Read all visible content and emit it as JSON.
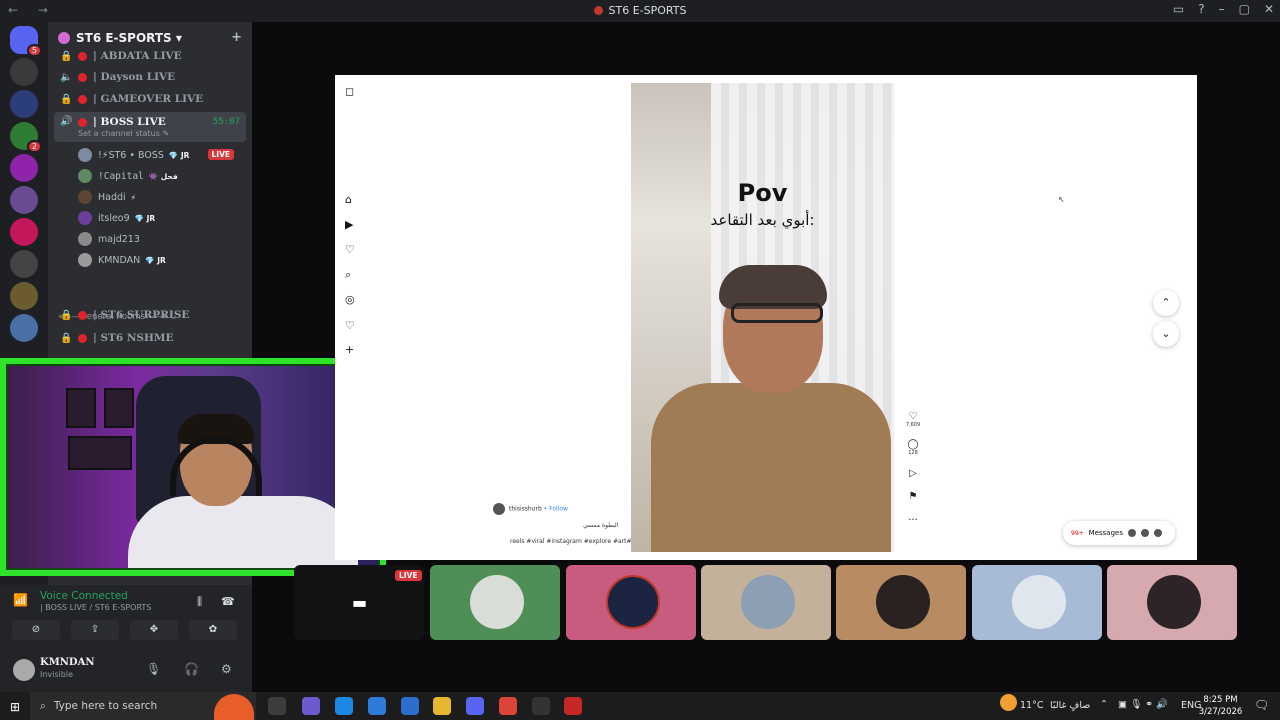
{
  "window": {
    "title": "ST6 E-SPORTS",
    "nav": "← →",
    "controls": [
      "▭",
      "?",
      "–",
      "▢",
      "✕"
    ]
  },
  "servers": [
    {
      "name": "discord-home",
      "color": "#5865f2",
      "badge": "5"
    },
    {
      "name": "st6",
      "color": "#3a3a3a",
      "badge": ""
    },
    {
      "name": "server-3",
      "color": "#2c3e7a",
      "badge": ""
    },
    {
      "name": "xjc",
      "color": "#2e7d32",
      "badge": "2"
    },
    {
      "name": "m7",
      "color": "#8e24aa",
      "badge": ""
    },
    {
      "name": "server-6",
      "color": "#6a4c93",
      "badge": ""
    },
    {
      "name": "mesk",
      "color": "#c2185b",
      "badge": ""
    },
    {
      "name": "server-8",
      "color": "#444",
      "badge": ""
    },
    {
      "name": "sx",
      "color": "#6b5b2e",
      "badge": ""
    },
    {
      "name": "server-10",
      "color": "#4a6fa5",
      "badge": ""
    }
  ],
  "guild": {
    "name": "ST6 E-SPORTS ▾",
    "add_user_icon": "+"
  },
  "channels": [
    {
      "name": "| ABDATA LIVE",
      "icon": "🔒",
      "y": -8
    },
    {
      "name": "| Dayson LIVE",
      "icon": "🔈",
      "y": 14
    },
    {
      "name": "| GAMEOVER LIVE",
      "icon": "🔒",
      "y": 37
    }
  ],
  "active_channel": {
    "name": "| BOSS LIVE",
    "time": "55:07",
    "status": "Set a channel status ✎"
  },
  "members": [
    {
      "name": "!⚡ST6 • BOSS",
      "tag": "💎 JR",
      "color": "#7d8aa0",
      "live": "LIVE"
    },
    {
      "name": "!Capital",
      "tag": "👾 فحل",
      "color": "#5e8a63",
      "live": ""
    },
    {
      "name": "Haddi",
      "tag": "⚡",
      "color": "#5b4636",
      "live": ""
    },
    {
      "name": "itsleo9",
      "tag": "💎 JR",
      "color": "#6b3e9a",
      "live": ""
    },
    {
      "name": "majd213",
      "tag": "",
      "color": "#8a8a8a",
      "live": ""
    },
    {
      "name": "KMNDAN",
      "tag": "💎 JR",
      "color": "#9a9a9a",
      "live": ""
    }
  ],
  "category": "«——General Rooms——» ⌄",
  "more_channels": [
    {
      "name": "| ST6 SURPRISE",
      "icon": "🔒"
    },
    {
      "name": "| ST6 NSHME",
      "icon": "🔒"
    }
  ],
  "instagram": {
    "pov": "Pov",
    "arabic_caption": "أبوي بعد التقاعد:",
    "likes": "7,609",
    "comments": "128",
    "account": "thisisshurb",
    "follow": "• Follow",
    "caption_line1": "البطوة ممسي",
    "caption_line2": "reels #viral #instagram #explore #art#",
    "messages": "Messages",
    "messages_badge": "99+",
    "side_icons": [
      "⌂",
      "▶",
      "♡",
      "⌕",
      "◎",
      "♡",
      "+"
    ],
    "action_icons": [
      "♡",
      "◯",
      "▷",
      "⚑",
      "···"
    ]
  },
  "tiles": {
    "live": "LIVE",
    "screen_icon": "▬"
  },
  "voice": {
    "title": "Voice Connected",
    "subtitle": "| BOSS LIVE / ST6 E-SPORTS",
    "buttons": [
      "⊘",
      "⇪",
      "✥",
      "✿"
    ]
  },
  "user": {
    "name": "KMNDAN",
    "status": "Invisible"
  },
  "taskbar": {
    "search_placeholder": "Type here to search",
    "weather": "11°C",
    "weather_text": "صافٍ غالبًا",
    "lang": "ENG",
    "time": "8:25 PM",
    "date": "3/27/2026",
    "notif": "4"
  }
}
